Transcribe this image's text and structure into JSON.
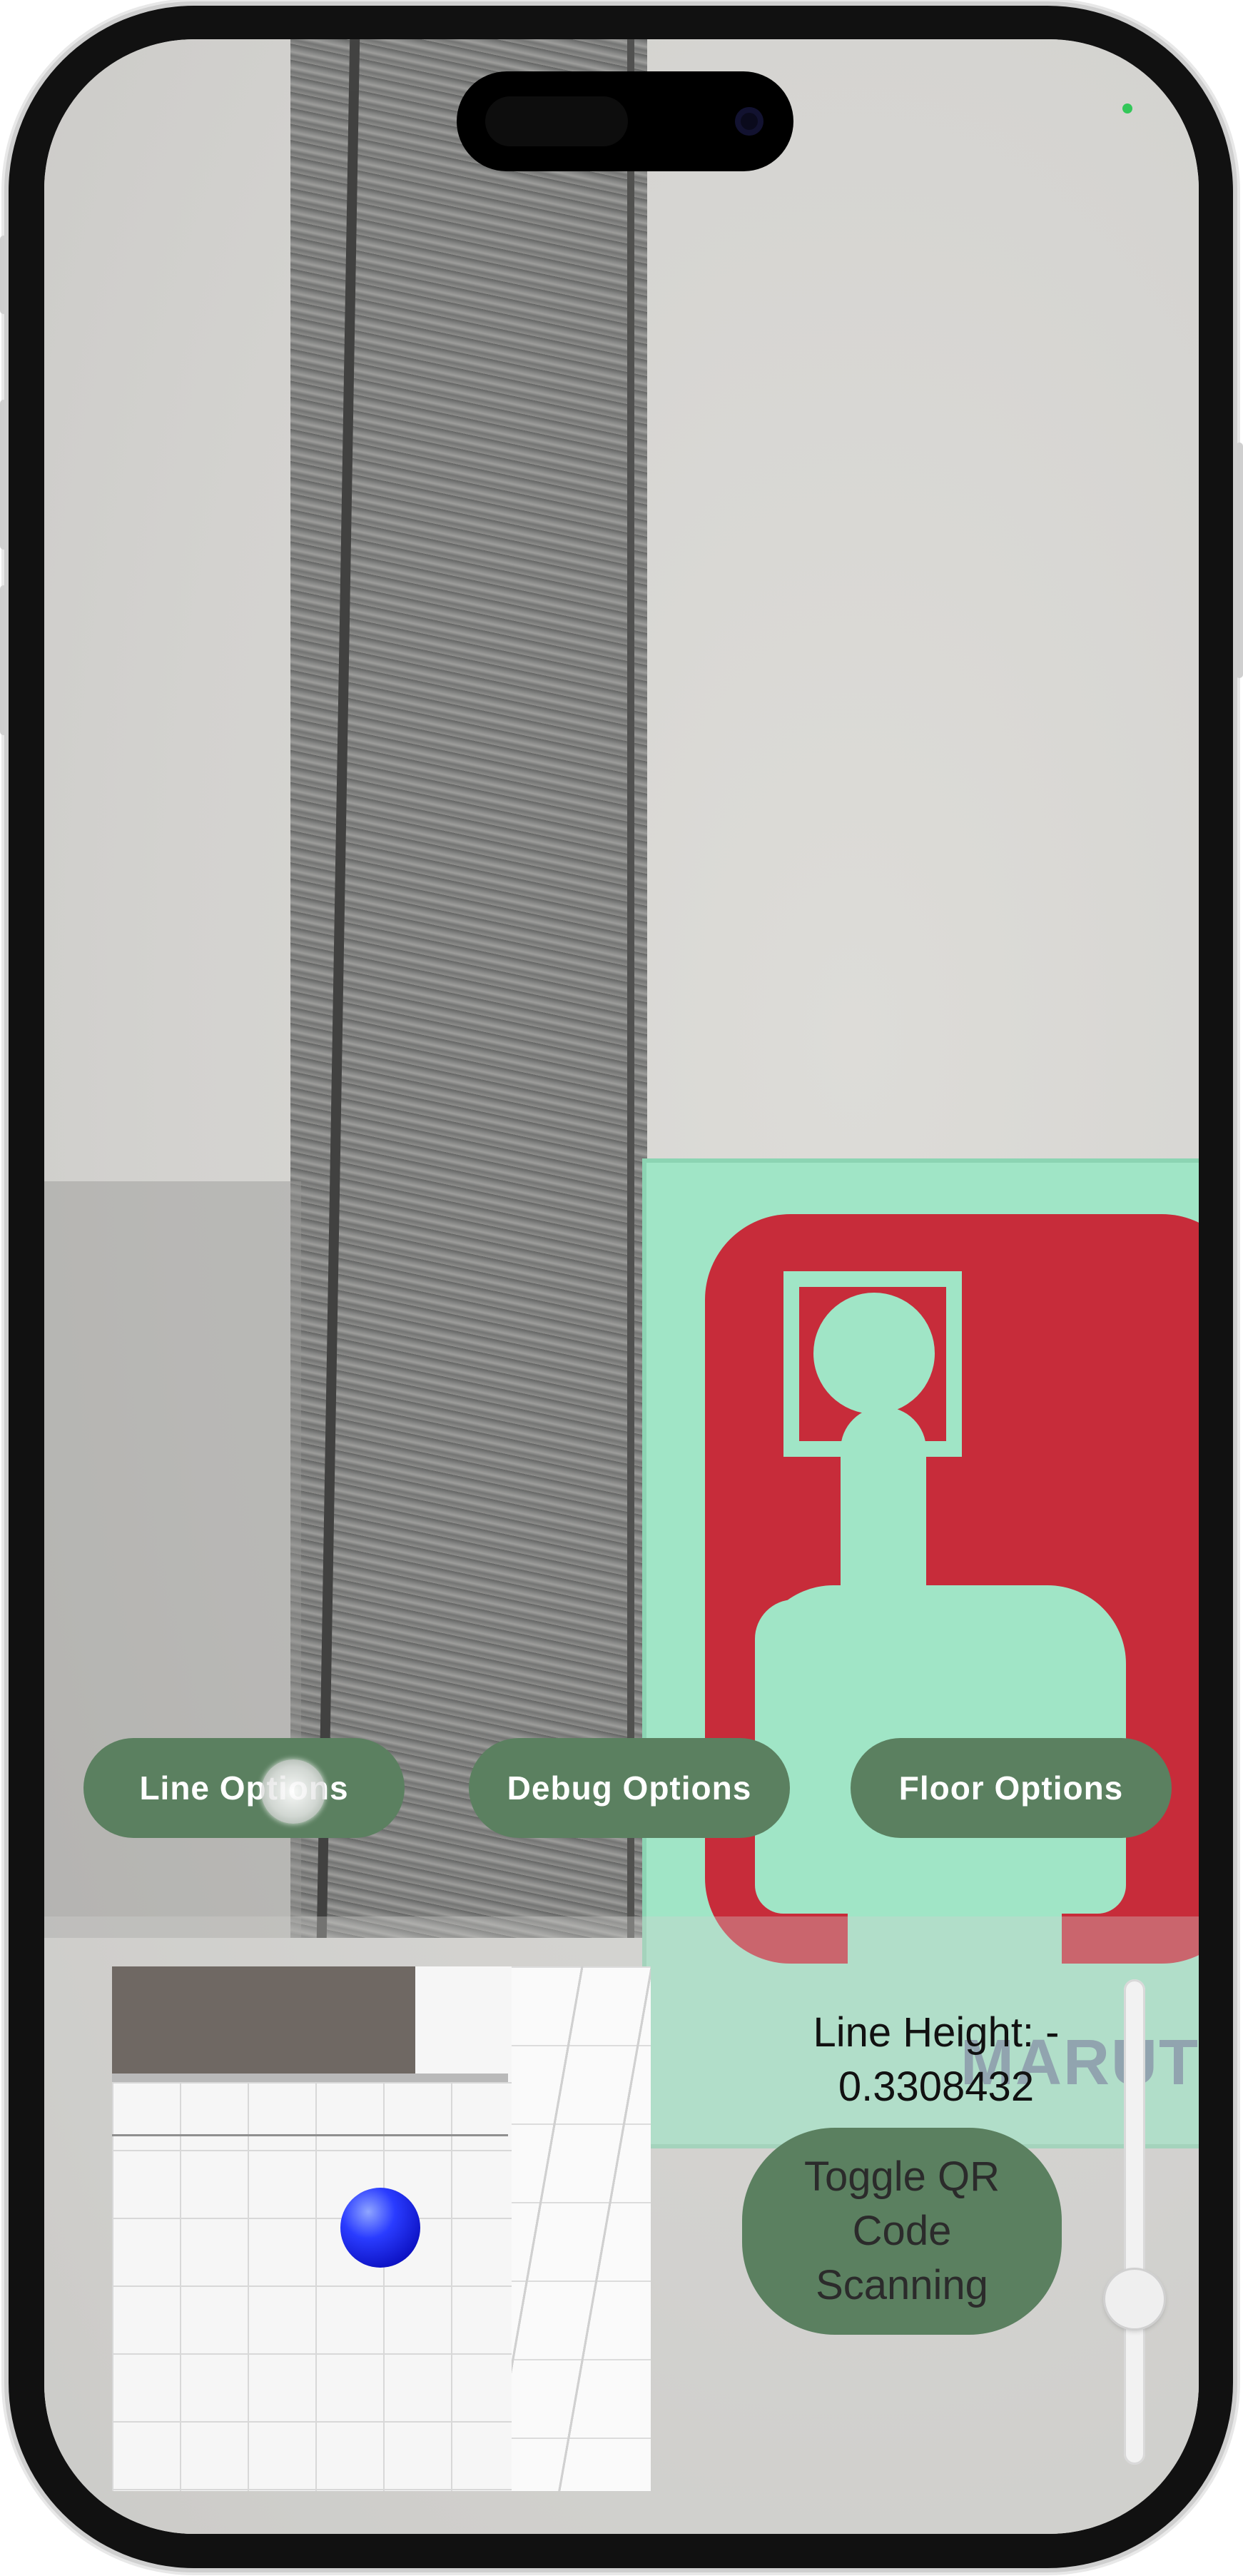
{
  "options": {
    "line_options": "Line Options",
    "debug_options": "Debug Options",
    "floor_options": "Floor Options"
  },
  "status": {
    "line_height_label": "Line Height: -",
    "line_height_value": "0.3308432"
  },
  "qr_toggle": {
    "line1": "Toggle QR",
    "line2": "Code",
    "line3": "Scanning"
  },
  "camera_scene": {
    "sign_text": "MARUT"
  },
  "slider": {
    "value_fraction": 0.6
  },
  "colors": {
    "button_green": "#5b8060",
    "privacy_indicator": "#33c759",
    "player_marker": "#2a3cff"
  }
}
